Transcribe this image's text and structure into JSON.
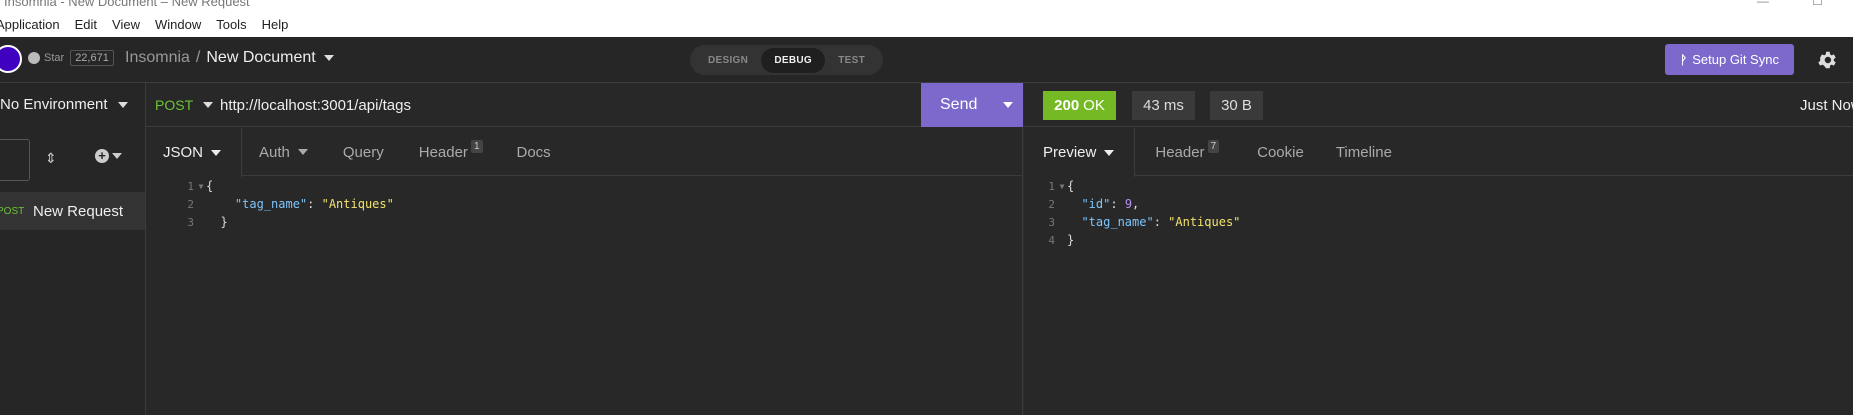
{
  "window": {
    "title": "Insomnia - New Document – New Request"
  },
  "menu": [
    "Application",
    "Edit",
    "View",
    "Window",
    "Tools",
    "Help"
  ],
  "header": {
    "github_star_label": "Star",
    "github_star_count": "22,671",
    "project": "Insomnia",
    "separator": "/",
    "document": "New Document",
    "modes": [
      "DESIGN",
      "DEBUG",
      "TEST"
    ],
    "active_mode": "DEBUG",
    "git_sync_label": "Setup Git Sync"
  },
  "sidebar": {
    "environment": "No Environment",
    "requests": [
      {
        "method": "POST",
        "name": "New Request"
      }
    ]
  },
  "request": {
    "method": "POST",
    "url": "http://localhost:3001/api/tags",
    "send_label": "Send",
    "tabs": [
      {
        "label": "JSON",
        "badge": "",
        "active": true
      },
      {
        "label": "Auth",
        "badge": ""
      },
      {
        "label": "Query",
        "badge": ""
      },
      {
        "label": "Header",
        "badge": "1"
      },
      {
        "label": "Docs",
        "badge": ""
      }
    ],
    "body_lines": [
      {
        "n": "1",
        "text": "{"
      },
      {
        "n": "2",
        "key": "\"tag_name\"",
        "value": "\"Antiques\""
      },
      {
        "n": "3",
        "text": "}"
      }
    ]
  },
  "response": {
    "status_code": "200",
    "status_text": "OK",
    "time": "43 ms",
    "size": "30 B",
    "when": "Just Now",
    "tabs": [
      {
        "label": "Preview",
        "badge": "",
        "active": true
      },
      {
        "label": "Header",
        "badge": "7"
      },
      {
        "label": "Cookie",
        "badge": ""
      },
      {
        "label": "Timeline",
        "badge": ""
      }
    ],
    "body_lines": [
      {
        "n": "1",
        "text": "{"
      },
      {
        "n": "2",
        "key": "\"id\"",
        "value": "9"
      },
      {
        "n": "3",
        "key": "\"tag_name\"",
        "value": "\"Antiques\""
      },
      {
        "n": "4",
        "text": "}"
      }
    ]
  },
  "colors": {
    "accent": "#7d69cb",
    "success": "#75ba24",
    "method_post": "#6ec337",
    "logo": "#4000bf"
  }
}
